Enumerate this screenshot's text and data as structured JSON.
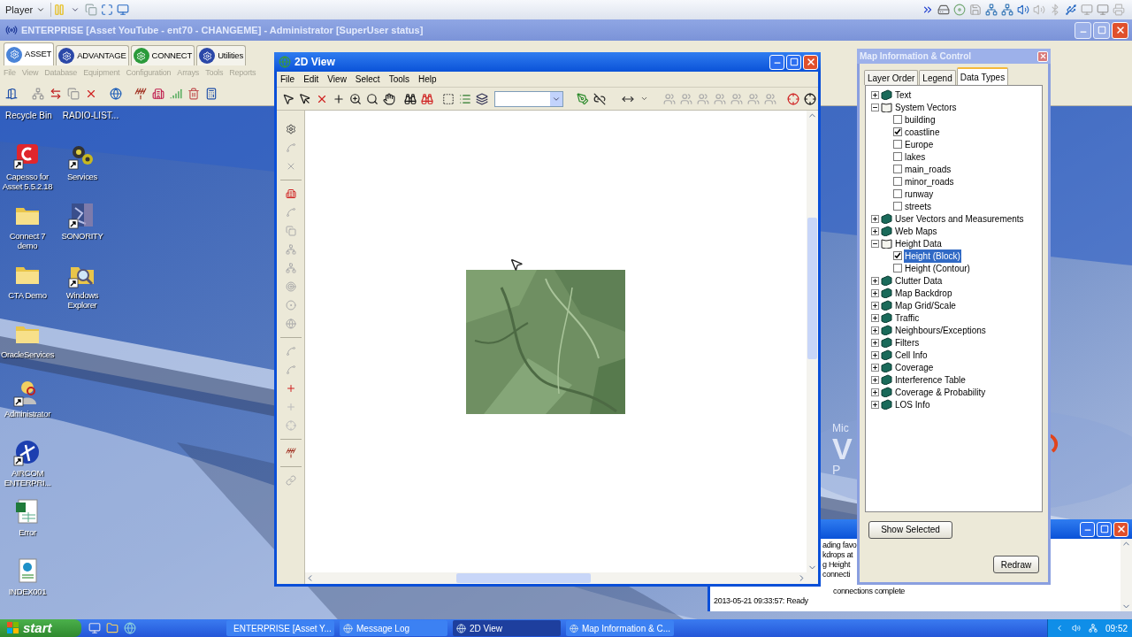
{
  "player": {
    "label": "Player"
  },
  "main_window": {
    "title": "ENTERPRISE [Asset YouTube - ent70 - CHANGEME] - Administrator [SuperUser status]",
    "tabs": [
      {
        "label": "ASSET",
        "selected": true
      },
      {
        "label": "ADVANTAGE",
        "selected": false
      },
      {
        "label": "CONNECT",
        "selected": false
      },
      {
        "label": "Utilities",
        "selected": false
      }
    ],
    "menu": [
      {
        "label": "File",
        "disabled": true
      },
      {
        "label": "View",
        "disabled": true
      },
      {
        "label": "Database",
        "disabled": true
      },
      {
        "label": "Equipment",
        "disabled": true
      },
      {
        "label": "Configuration",
        "disabled": true
      },
      {
        "label": "Arrays",
        "disabled": true
      },
      {
        "label": "Tools",
        "disabled": true
      },
      {
        "label": "Reports",
        "disabled": true
      }
    ]
  },
  "desktop": {
    "top_labels": [
      "Recycle Bin",
      "RADIO-LIST..."
    ],
    "columns": [
      [
        {
          "label": "Capesso for Asset 5.5.2.18",
          "kind": "capesso",
          "shortcut": true
        },
        {
          "label": "Connect 7 demo",
          "kind": "folder",
          "shortcut": false
        },
        {
          "label": "CTA Demo",
          "kind": "folder",
          "shortcut": false
        },
        {
          "label": "OracleServices",
          "kind": "folder",
          "shortcut": false
        },
        {
          "label": "Administrator",
          "kind": "admin",
          "shortcut": true
        },
        {
          "label": "AIRCOM ENTERPRI...",
          "kind": "aircom",
          "shortcut": true
        },
        {
          "label": "Error",
          "kind": "spreadsheet",
          "shortcut": false
        },
        {
          "label": "INDEX001",
          "kind": "webpage",
          "shortcut": false
        }
      ],
      [
        {
          "label": "Services",
          "kind": "gears",
          "shortcut": true
        },
        {
          "label": "SONORITY",
          "kind": "sonority",
          "shortcut": true
        },
        {
          "label": "Windows Explorer",
          "kind": "explorer",
          "shortcut": true
        }
      ]
    ],
    "wallpaper_texts": [
      "Mic",
      "V",
      "P"
    ]
  },
  "view2d": {
    "title": "2D View",
    "menu": [
      "File",
      "Edit",
      "View",
      "Select",
      "Tools",
      "Help"
    ]
  },
  "map_info": {
    "title": "Map Information & Control",
    "tabs": [
      {
        "label": "Layer Order",
        "selected": false
      },
      {
        "label": "Legend",
        "selected": false
      },
      {
        "label": "Data Types",
        "selected": true
      }
    ],
    "tree": [
      {
        "label": "Text",
        "expanded": false,
        "selected": false
      },
      {
        "label": "System Vectors",
        "expanded": true,
        "selected": false,
        "children": [
          {
            "label": "building",
            "checked": false,
            "selected": false
          },
          {
            "label": "coastline",
            "checked": true,
            "selected": false
          },
          {
            "label": "Europe",
            "checked": false,
            "selected": false
          },
          {
            "label": "lakes",
            "checked": false,
            "selected": false
          },
          {
            "label": "main_roads",
            "checked": false,
            "selected": false
          },
          {
            "label": "minor_roads",
            "checked": false,
            "selected": false
          },
          {
            "label": "runway",
            "checked": false,
            "selected": false
          },
          {
            "label": "streets",
            "checked": false,
            "selected": false
          }
        ]
      },
      {
        "label": "User Vectors and Measurements",
        "expanded": false,
        "selected": false
      },
      {
        "label": "Web Maps",
        "expanded": false,
        "selected": false
      },
      {
        "label": "Height Data",
        "expanded": true,
        "selected": false,
        "children": [
          {
            "label": "Height (Block)",
            "checked": true,
            "selected": true
          },
          {
            "label": "Height (Contour)",
            "checked": false,
            "selected": false
          }
        ]
      },
      {
        "label": "Clutter Data",
        "expanded": false,
        "selected": false
      },
      {
        "label": "Map Backdrop",
        "expanded": false,
        "selected": false
      },
      {
        "label": "Map Grid/Scale",
        "expanded": false,
        "selected": false
      },
      {
        "label": "Traffic",
        "expanded": false,
        "selected": false
      },
      {
        "label": "Neighbours/Exceptions",
        "expanded": false,
        "selected": false
      },
      {
        "label": "Filters",
        "expanded": false,
        "selected": false
      },
      {
        "label": "Cell Info",
        "expanded": false,
        "selected": false
      },
      {
        "label": "Coverage",
        "expanded": false,
        "selected": false
      },
      {
        "label": "Interference Table",
        "expanded": false,
        "selected": false
      },
      {
        "label": "Coverage & Probability",
        "expanded": false,
        "selected": false
      },
      {
        "label": "LOS Info",
        "expanded": false,
        "selected": false
      }
    ],
    "show_selected": "Show Selected",
    "redraw": "Redraw"
  },
  "message_log": {
    "lines": [
      "ading favo",
      "kdrops at",
      "g Height",
      "connecti",
      "connections complete",
      "2013-05-21 09:33:57: Ready"
    ]
  },
  "taskbar": {
    "start": "start",
    "tasks": [
      {
        "label": "ENTERPRISE [Asset Y...",
        "selected": false
      },
      {
        "label": "Message Log",
        "selected": false
      },
      {
        "label": "2D View",
        "selected": true
      },
      {
        "label": "Map Information & C...",
        "selected": false
      }
    ],
    "clock": "09:52"
  }
}
